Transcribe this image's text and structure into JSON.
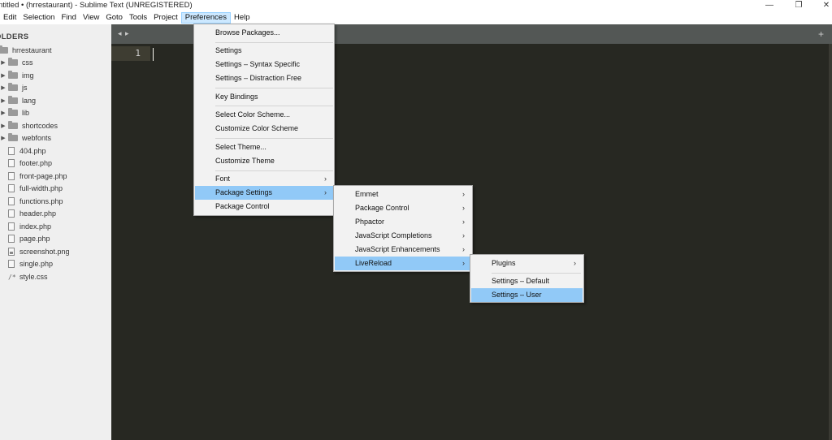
{
  "window": {
    "title": "ntitled • (hrrestaurant) - Sublime Text (UNREGISTERED)",
    "controls": {
      "minimize": "—",
      "restore": "❐",
      "close": "✕"
    }
  },
  "menubar": {
    "items": [
      "Edit",
      "Selection",
      "Find",
      "View",
      "Goto",
      "Tools",
      "Project",
      "Preferences",
      "Help"
    ],
    "active": "Preferences"
  },
  "sidebar": {
    "header": "OLDERS",
    "project": "hrrestaurant",
    "folders": [
      "css",
      "img",
      "js",
      "lang",
      "lib",
      "shortcodes",
      "webfonts"
    ],
    "files": [
      "404.php",
      "footer.php",
      "front-page.php",
      "full-width.php",
      "functions.php",
      "header.php",
      "index.php",
      "page.php",
      "screenshot.png",
      "single.php",
      "style.css"
    ]
  },
  "editor": {
    "tab_nav": "◂ ▸",
    "new_tab": "+",
    "line_number": "1"
  },
  "preferences_menu": {
    "items": {
      "browse_packages": "Browse Packages...",
      "settings": "Settings",
      "settings_syntax": "Settings – Syntax Specific",
      "settings_distraction": "Settings – Distraction Free",
      "key_bindings": "Key Bindings",
      "select_color_scheme": "Select Color Scheme...",
      "customize_color_scheme": "Customize Color Scheme",
      "select_theme": "Select Theme...",
      "customize_theme": "Customize Theme",
      "font": "Font",
      "package_settings": "Package Settings",
      "package_control": "Package Control"
    },
    "submenu_arrow": "›"
  },
  "package_settings_menu": {
    "items": [
      "Emmet",
      "Package Control",
      "Phpactor",
      "JavaScript Completions",
      "JavaScript Enhancements",
      "LiveReload"
    ],
    "highlighted": "LiveReload"
  },
  "livereload_menu": {
    "plugins": "Plugins",
    "settings_default": "Settings – Default",
    "settings_user": "Settings – User",
    "highlighted": "Settings – User"
  },
  "colors": {
    "editor_bg": "#272822",
    "tabbar_bg": "#535755",
    "sidebar_bg": "#efefef",
    "menu_highlight": "#91c9f7",
    "menubar_active": "#cce8ff"
  }
}
